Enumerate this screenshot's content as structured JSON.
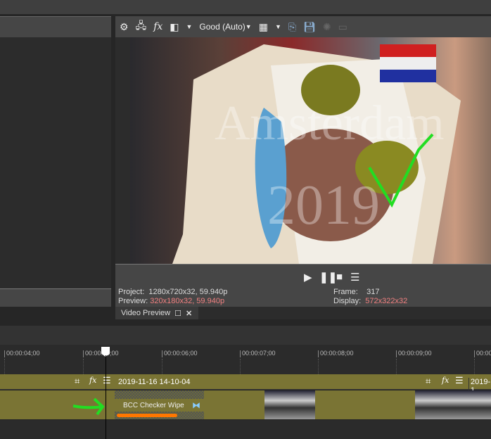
{
  "toolbar": {
    "quality": "Good (Auto)",
    "icons": [
      "gear-icon",
      "split-screen-icon",
      "fx-icon",
      "external-monitor-icon",
      "grid-icon",
      "copy-snapshot-icon",
      "save-snapshot-icon",
      "color-icon",
      "hdr-icon"
    ]
  },
  "video": {
    "watermark_line1": "Amsterdam",
    "watermark_line2": "2019"
  },
  "info": {
    "project_label": "Project:",
    "project_value": "1280x720x32, 59.940p",
    "preview_label": "Preview:",
    "preview_value": "320x180x32, 59.940p",
    "frame_label": "Frame:",
    "frame_value": "317",
    "display_label": "Display:",
    "display_value": "572x322x32"
  },
  "tab": {
    "label": "Video Preview"
  },
  "ruler": [
    "00:00:04;00",
    "00:00:05;00",
    "00:00:06;00",
    "00:00:07;00",
    "00:00:08;00",
    "00:00:09;00",
    "00:00:1"
  ],
  "track": {
    "event1_title": "2019-11-16 14-10-04",
    "event2_title": "2019-1",
    "transition": "BCC Checker Wipe"
  },
  "colors": {
    "accent": "#7a7434",
    "annotation": "#22dd22",
    "warning": "#ff7700",
    "value_red": "#f08080"
  }
}
